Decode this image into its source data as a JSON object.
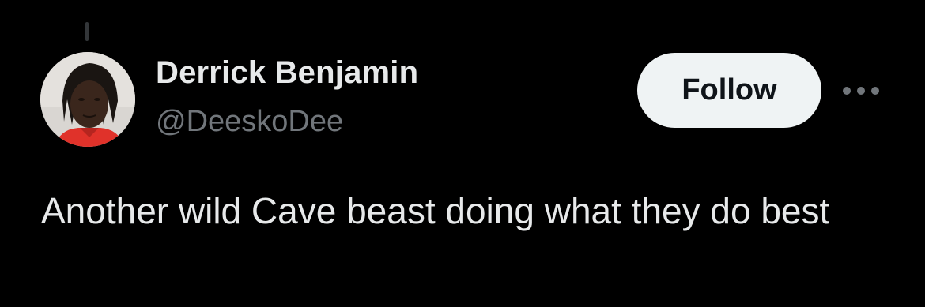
{
  "author": {
    "name": "Derrick Benjamin",
    "handle": "@DeeskoDee"
  },
  "follow_label": "Follow",
  "more_icon": "more-horizontal-icon",
  "tweet_text": "Another wild Cave beast doing what they do best",
  "colors": {
    "background": "#000000",
    "name": "#e7e9ea",
    "handle": "#71767b",
    "follow_bg": "#eff3f4",
    "follow_text": "#0f1419"
  }
}
